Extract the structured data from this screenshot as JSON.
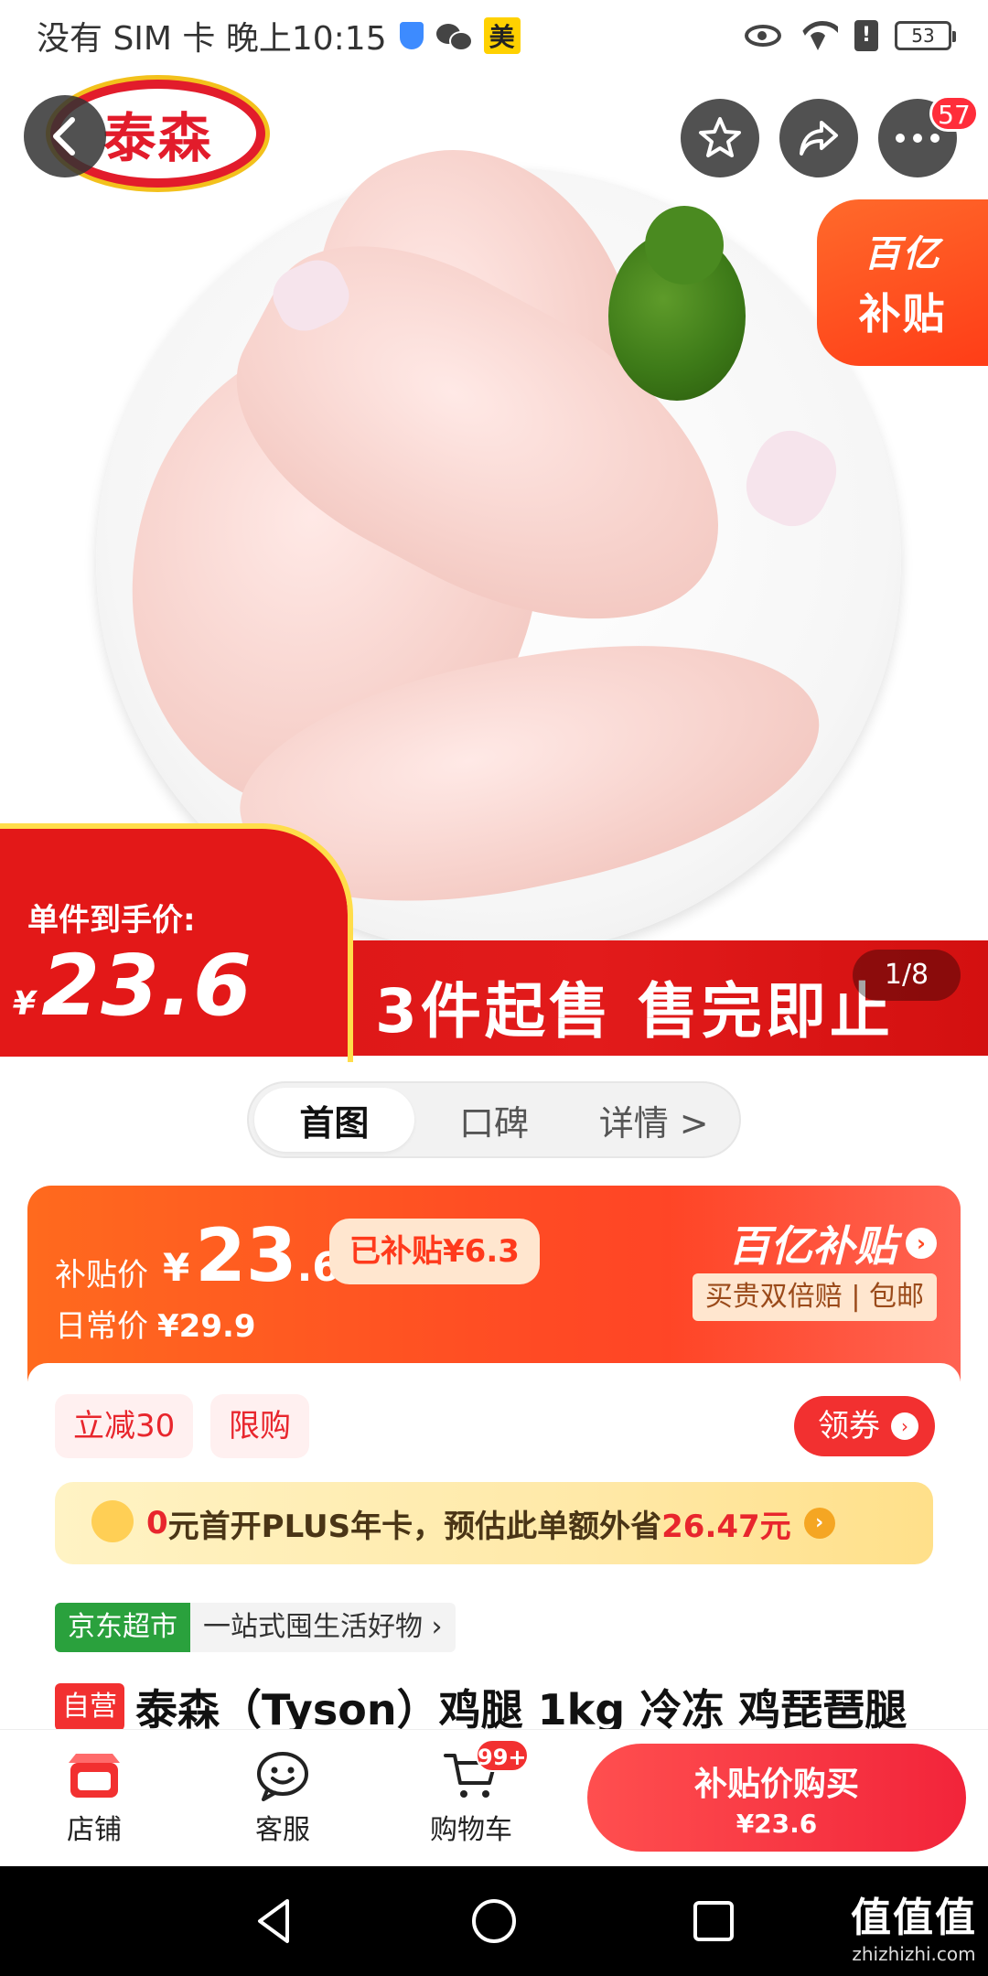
{
  "status_bar": {
    "carrier_time": "没有 SIM 卡 晚上10:15",
    "app_badge": "美",
    "alert": "!",
    "battery": "53"
  },
  "header": {
    "brand_logo": "泰森",
    "cart_badge_count": "57"
  },
  "hero": {
    "subsidy_badge_line1": "百亿",
    "subsidy_badge_line2": "补贴",
    "unit_price_label": "单件到手价:",
    "unit_price_currency": "¥",
    "unit_price_value": "23.6",
    "slogan": "3件起售 售完即止",
    "image_counter": "1/8"
  },
  "tabs": [
    {
      "label": "首图",
      "active": true
    },
    {
      "label": "口碑",
      "active": false
    },
    {
      "label": "详情 >",
      "active": false
    }
  ],
  "price_card": {
    "subsidy_label": "补贴价",
    "currency": "¥",
    "price_int": "23",
    "price_dec": ".6",
    "subsidized": "已补贴¥6.3",
    "regular_label": "日常价",
    "regular_price": "¥29.9",
    "brand": "百亿补贴",
    "guarantee": "买贵双倍赔 | 包邮"
  },
  "promo": {
    "discount_tag": "立减30",
    "limit_tag": "限购",
    "coupon_button": "领券",
    "plus_banner_prefix": "0",
    "plus_banner_text": "元首开PLUS年卡，预估此单额外省",
    "plus_banner_amount": "26.47元"
  },
  "market": {
    "name": "京东超市",
    "slogan": "一站式囤生活好物 ›"
  },
  "product": {
    "self_tag": "自营",
    "title": "泰森（Tyson）鸡腿 1kg 冷冻 鸡琵琶腿"
  },
  "bottom_bar": {
    "store_label": "店铺",
    "service_label": "客服",
    "cart_label": "购物车",
    "cart_badge": "99+",
    "buy_label": "补贴价购买",
    "buy_price": "¥23.6"
  },
  "watermark": {
    "line1": "值值值",
    "line2": "zhizhizhi.com"
  },
  "colors": {
    "accent_red": "#f23030",
    "subsidy_orange": "#ff4a24",
    "banner_red": "#e21b1b",
    "market_green": "#2aa13d"
  }
}
